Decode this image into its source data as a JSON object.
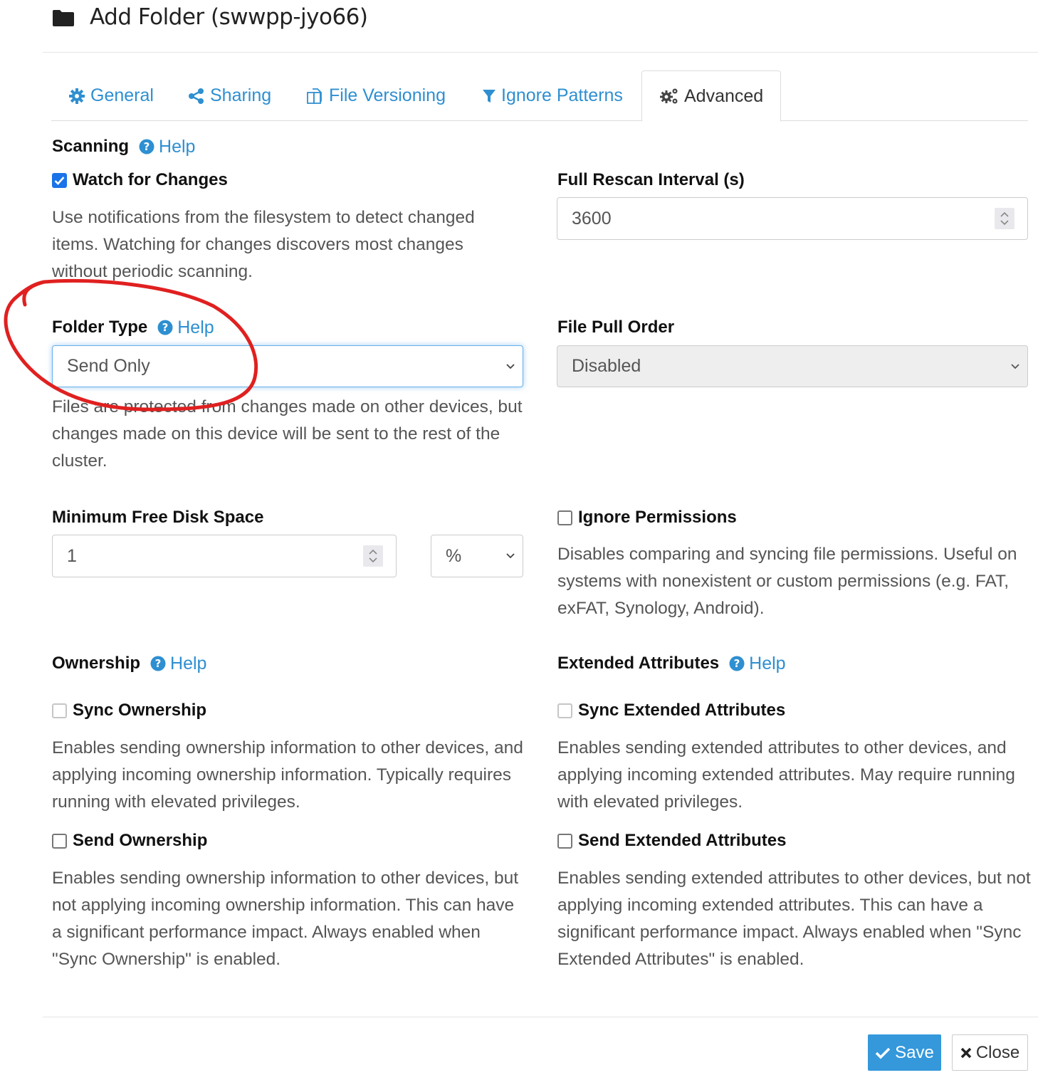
{
  "dialog": {
    "title": "Add Folder (swwpp-jyo66)",
    "icon": "folder-icon"
  },
  "tabs": [
    {
      "label": "General",
      "icon": "gear-icon",
      "active": false
    },
    {
      "label": "Sharing",
      "icon": "share-icon",
      "active": false
    },
    {
      "label": "File Versioning",
      "icon": "copy-icon",
      "active": false
    },
    {
      "label": "Ignore Patterns",
      "icon": "filter-icon",
      "active": false
    },
    {
      "label": "Advanced",
      "icon": "gears-icon",
      "active": true
    }
  ],
  "scanning": {
    "label": "Scanning",
    "help": "Help",
    "watch": {
      "label": "Watch for Changes",
      "checked": true,
      "description": "Use notifications from the filesystem to detect changed items. Watching for changes discovers most changes without periodic scanning."
    },
    "rescan": {
      "label": "Full Rescan Interval (s)",
      "value": "3600"
    }
  },
  "folder_type": {
    "label": "Folder Type",
    "help": "Help",
    "selected": "Send Only",
    "description": "Files are protected from changes made on other devices, but changes made on this device will be sent to the rest of the cluster."
  },
  "pull_order": {
    "label": "File Pull Order",
    "selected": "Disabled",
    "disabled": true
  },
  "min_disk": {
    "label": "Minimum Free Disk Space",
    "value": "1",
    "unit": "%"
  },
  "ignore_perms": {
    "label": "Ignore Permissions",
    "checked": false,
    "description": "Disables comparing and syncing file permissions. Useful on systems with nonexistent or custom permissions (e.g. FAT, exFAT, Synology, Android)."
  },
  "ownership": {
    "label": "Ownership",
    "help": "Help",
    "sync": {
      "label": "Sync Ownership",
      "checked": false,
      "description": "Enables sending ownership information to other devices, and applying incoming ownership information. Typically requires running with elevated privileges."
    },
    "send": {
      "label": "Send Ownership",
      "checked": false,
      "description": "Enables sending ownership information to other devices, but not applying incoming ownership information. This can have a significant performance impact. Always enabled when \"Sync Ownership\" is enabled."
    }
  },
  "xattrs": {
    "label": "Extended Attributes",
    "help": "Help",
    "sync": {
      "label": "Sync Extended Attributes",
      "checked": false,
      "description": "Enables sending extended attributes to other devices, and applying incoming extended attributes. May require running with elevated privileges."
    },
    "send": {
      "label": "Send Extended Attributes",
      "checked": false,
      "description": "Enables sending extended attributes to other devices, but not applying incoming extended attributes. This can have a significant performance impact. Always enabled when \"Sync Extended Attributes\" is enabled."
    }
  },
  "footer": {
    "save": "Save",
    "close": "Close"
  },
  "colors": {
    "link": "#2e8fd1",
    "primary": "#3498db",
    "annotation": "#e02020"
  }
}
